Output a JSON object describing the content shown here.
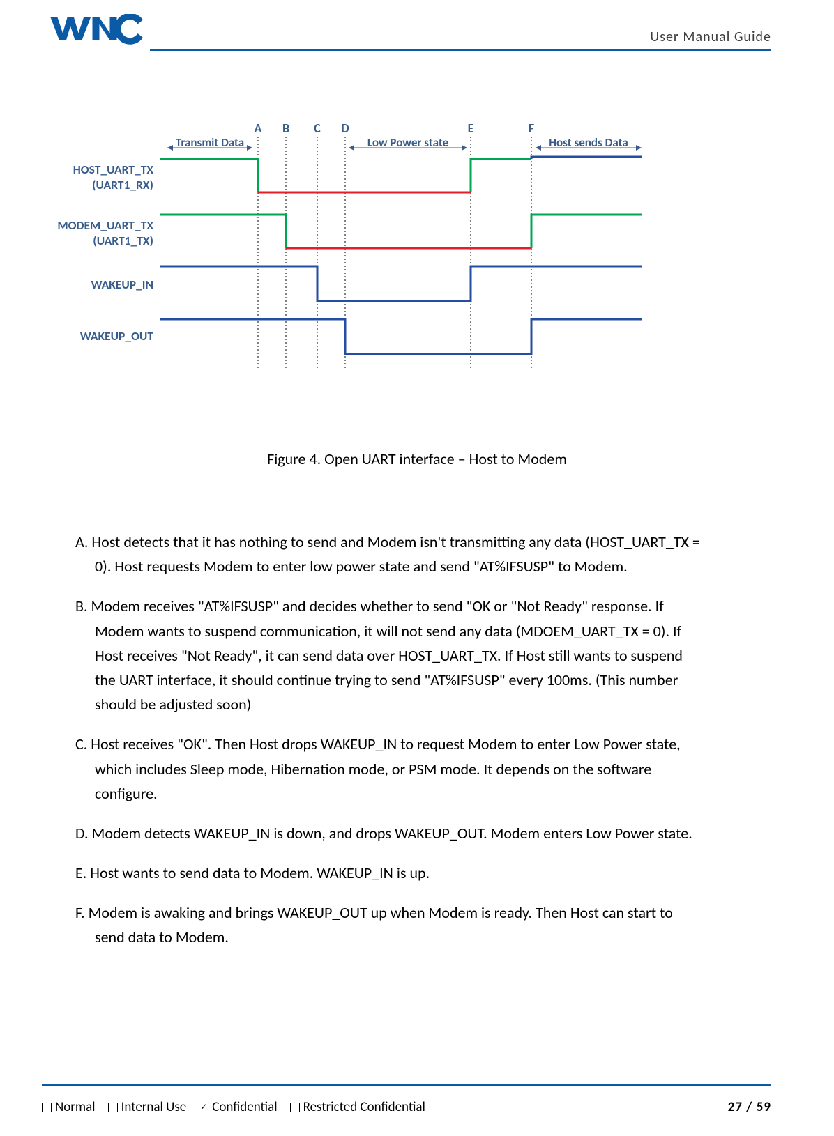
{
  "header": {
    "logo_text": "WNC",
    "title": "User  Manual  Guide"
  },
  "chart_data": {
    "type": "timing_diagram",
    "time_markers": [
      "A",
      "B",
      "C",
      "D",
      "E",
      "F"
    ],
    "top_annotations": {
      "before_A": "Transmit Data",
      "D_to_E": "Low Power state",
      "after_F": "Host sends Data"
    },
    "signals": [
      {
        "name": "HOST_UART_TX",
        "sub": "(UART1_RX)",
        "segments": [
          {
            "from": "start",
            "to": "A",
            "level": "high",
            "color": "green"
          },
          {
            "from": "A",
            "to": "E",
            "level": "low",
            "color": "red"
          },
          {
            "from": "E",
            "to": "F",
            "level": "high",
            "color": "green"
          },
          {
            "from": "F",
            "to": "end",
            "level": "high",
            "color": "blue_rising"
          }
        ]
      },
      {
        "name": "MODEM_UART_TX",
        "sub": "(UART1_TX)",
        "segments": [
          {
            "from": "start",
            "to": "B",
            "level": "high",
            "color": "green"
          },
          {
            "from": "B",
            "to": "F",
            "level": "low",
            "color": "red"
          },
          {
            "from": "F",
            "to": "end",
            "level": "high",
            "color": "green"
          }
        ]
      },
      {
        "name": "WAKEUP_IN",
        "segments": [
          {
            "from": "start",
            "to": "C",
            "level": "high",
            "color": "blue"
          },
          {
            "from": "C",
            "to": "E",
            "level": "low",
            "color": "blue"
          },
          {
            "from": "E",
            "to": "end",
            "level": "high",
            "color": "blue"
          }
        ]
      },
      {
        "name": "WAKEUP_OUT",
        "segments": [
          {
            "from": "start",
            "to": "D",
            "level": "high",
            "color": "blue"
          },
          {
            "from": "D",
            "to": "F",
            "level": "low",
            "color": "blue"
          },
          {
            "from": "F",
            "to": "end",
            "level": "high",
            "color": "blue"
          }
        ]
      }
    ]
  },
  "labels": {
    "host": "HOST_UART_TX (UART1_RX)",
    "modem": "MODEM_UART_TX (UART1_TX)",
    "win": "WAKEUP_IN",
    "wout": "WAKEUP_OUT",
    "A": "A",
    "B": "B",
    "C": "C",
    "D": "D",
    "E": "E",
    "F": "F",
    "transmit": "Transmit Data",
    "lowpower": "Low Power state",
    "hostsends": "Host sends Data"
  },
  "caption": "Figure 4.  Open UART interface – Host to Modem",
  "paragraphs": {
    "a": "A. Host detects that it has nothing to send and Modem isn't transmitting any data (HOST_UART_TX = 0). Host requests Modem to enter low power state and send \"AT%IFSUSP\" to Modem.",
    "b": "B. Modem receives \"AT%IFSUSP\" and decides whether to send \"OK or \"Not Ready\" response. If Modem wants to suspend communication, it will not send any data (MDOEM_UART_TX = 0). If Host receives \"Not Ready\", it can send data over HOST_UART_TX. If Host still wants to suspend the UART interface, it should continue trying to send \"AT%IFSUSP\" every 100ms. (This number should be adjusted soon)",
    "c": "C. Host receives \"OK\". Then Host drops WAKEUP_IN to request Modem to enter Low Power state, which includes Sleep mode, Hibernation mode, or PSM mode. It depends on the software configure.",
    "d": "D. Modem detects WAKEUP_IN is down, and drops WAKEUP_OUT. Modem enters Low Power state.",
    "e": "E. Host wants to send data to Modem. WAKEUP_IN is up.",
    "f": "F. Modem is awaking and brings WAKEUP_OUT up when Modem is ready. Then Host can start to send data to Modem."
  },
  "footer": {
    "normal": "Normal",
    "internal": "Internal Use",
    "confidential": "Confidential",
    "restricted": "Restricted Confidential",
    "page": "27 / 59"
  }
}
